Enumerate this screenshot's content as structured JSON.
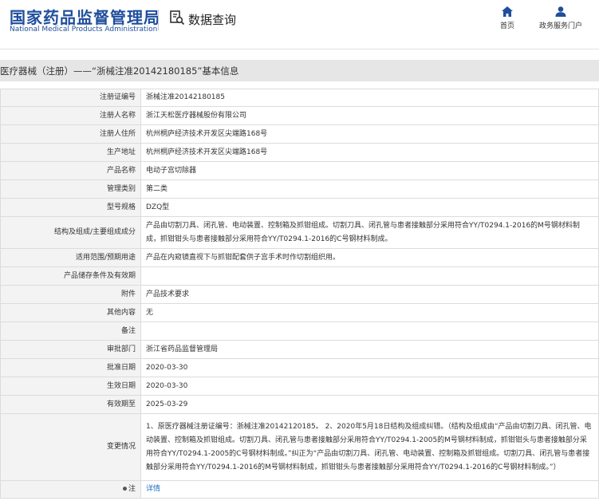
{
  "header": {
    "logo_cn": "国家药品监督管理局",
    "logo_en": "National Medical Products Administration",
    "query_label": "数据查询",
    "nav": {
      "home": "首页",
      "service": "政务服务门户"
    }
  },
  "title": "医疗器械（注册）——“浙械注准20142180185”基本信息",
  "rows": [
    {
      "label": "注册证编号",
      "value": "浙械注准20142180185"
    },
    {
      "label": "注册人名称",
      "value": "浙江天松医疗器械股份有限公司"
    },
    {
      "label": "注册人住所",
      "value": "杭州桐庐经济技术开发区尖端路168号"
    },
    {
      "label": "生产地址",
      "value": "杭州桐庐经济技术开发区尖端路168号"
    },
    {
      "label": "产品名称",
      "value": "电动子宫切除器"
    },
    {
      "label": "管理类别",
      "value": "第二类"
    },
    {
      "label": "型号规格",
      "value": "DZQ型"
    },
    {
      "label": "结构及组成/主要组成成分",
      "value": "产品由切割刀具、闭孔管、电动装置、控制箱及抓钳组成。切割刀具、闭孔管与患者接触部分采用符合YY/T0294.1-2016的M号钢材料制成，抓钳钳头与患者接触部分采用符合YY/T0294.1-2016的C号钢材料制成。"
    },
    {
      "label": "适用范围/预期用途",
      "value": "产品在内窥镜直视下与抓钳配套供子宫手术时作切割组织用。"
    },
    {
      "label": "产品储存条件及有效期",
      "value": ""
    },
    {
      "label": "附件",
      "value": "产品技术要求"
    },
    {
      "label": "其他内容",
      "value": "无"
    },
    {
      "label": "备注",
      "value": ""
    },
    {
      "label": "审批部门",
      "value": "浙江省药品监督管理局"
    },
    {
      "label": "批准日期",
      "value": "2020-03-30"
    },
    {
      "label": "生效日期",
      "value": "2020-03-30"
    },
    {
      "label": "有效期至",
      "value": "2025-03-29"
    },
    {
      "label": "变更情况",
      "value": "1、原医疗器械注册证编号：浙械注准20142120185。 2、2020年5月18日结构及组成纠错。（结构及组成由“产品由切割刀具、闭孔管、电动装置、控制箱及抓钳组成。切割刀具、闭孔管与患者接触部分采用符合YY/T0294.1-2005的M号钢材料制成，抓钳钳头与患者接触部分采用符合YY/T0294.1-2005的C号钢材料制成。”纠正为“产品由切割刀具、闭孔管、电动装置、控制箱及抓钳组成。切割刀具、闭孔管与患者接触部分采用符合YY/T0294.1-2016的M号钢材料制成，抓钳钳头与患者接触部分采用符合YY/T0294.1-2016的C号钢材料制成。”）"
    }
  ],
  "note_row": {
    "label": "注",
    "link": "详情"
  }
}
